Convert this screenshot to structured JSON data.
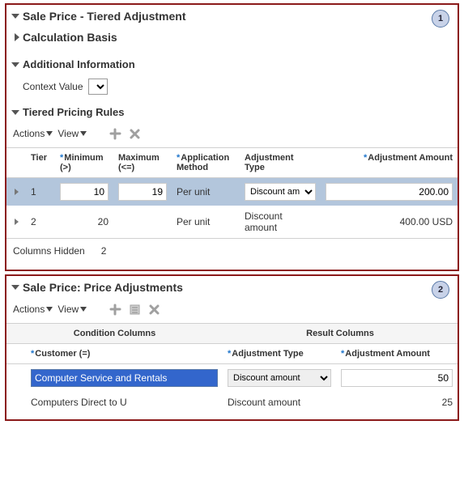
{
  "panel1": {
    "badge": "1",
    "title": "Sale Price - Tiered Adjustment",
    "calc_basis": "Calculation Basis",
    "additional_info": "Additional Information",
    "context_value_label": "Context Value",
    "tiered_rules": "Tiered Pricing Rules",
    "actions_label": "Actions",
    "view_label": "View",
    "columns": {
      "tier": "Tier",
      "minimum": "Minimum",
      "minimum_sub": "(>)",
      "maximum": "Maximum",
      "maximum_sub": "(<=)",
      "app_method": "Application Method",
      "adj_type": "Adjustment Type",
      "adj_amount": "Adjustment Amount"
    },
    "rows": [
      {
        "tier": "1",
        "min": "10",
        "max": "19",
        "method": "Per unit",
        "type": "Discount am",
        "amount": "200.00"
      },
      {
        "tier": "2",
        "min": "20",
        "max": "",
        "method": "Per unit",
        "type": "Discount amount",
        "amount": "400.00 USD"
      }
    ],
    "columns_hidden_label": "Columns Hidden",
    "columns_hidden_count": "2"
  },
  "panel2": {
    "badge": "2",
    "title": "Sale Price: Price Adjustments",
    "actions_label": "Actions",
    "view_label": "View",
    "group_condition": "Condition Columns",
    "group_result": "Result Columns",
    "columns": {
      "customer": "Customer (=)",
      "adj_type": "Adjustment Type",
      "adj_amount": "Adjustment Amount"
    },
    "rows": [
      {
        "customer": "Computer Service and Rentals",
        "type": "Discount amount",
        "amount": "50"
      },
      {
        "customer": "Computers Direct to U",
        "type": "Discount amount",
        "amount": "25"
      }
    ]
  }
}
